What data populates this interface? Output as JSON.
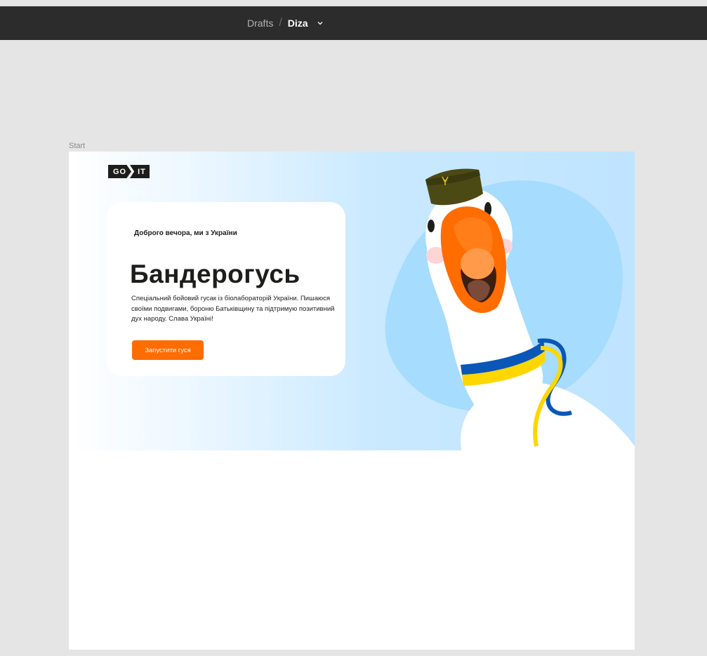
{
  "toolbar": {
    "breadcrumb_parent": "Drafts",
    "breadcrumb_separator": "/",
    "breadcrumb_current": "Diza"
  },
  "frame": {
    "label": "Start"
  },
  "landing": {
    "logo": {
      "left": "GO",
      "right": "IT"
    },
    "greeting": "Доброго вечора, ми з України",
    "title": "Бандерогусь",
    "description": "Спеціальний бойовий гусак із біолабораторій України. Пишаюся своїми подвигами, бороню Батьківщину та підтримую позитивний дух народу. Слава Україні!",
    "cta_label": "Запустити гуся"
  },
  "colors": {
    "toolbar_bg": "#2c2c2c",
    "canvas_bg": "#e5e5e5",
    "accent": "#ff6c00",
    "text_dark": "#1d1d1b",
    "hero_blue": "#a6dcfd"
  }
}
